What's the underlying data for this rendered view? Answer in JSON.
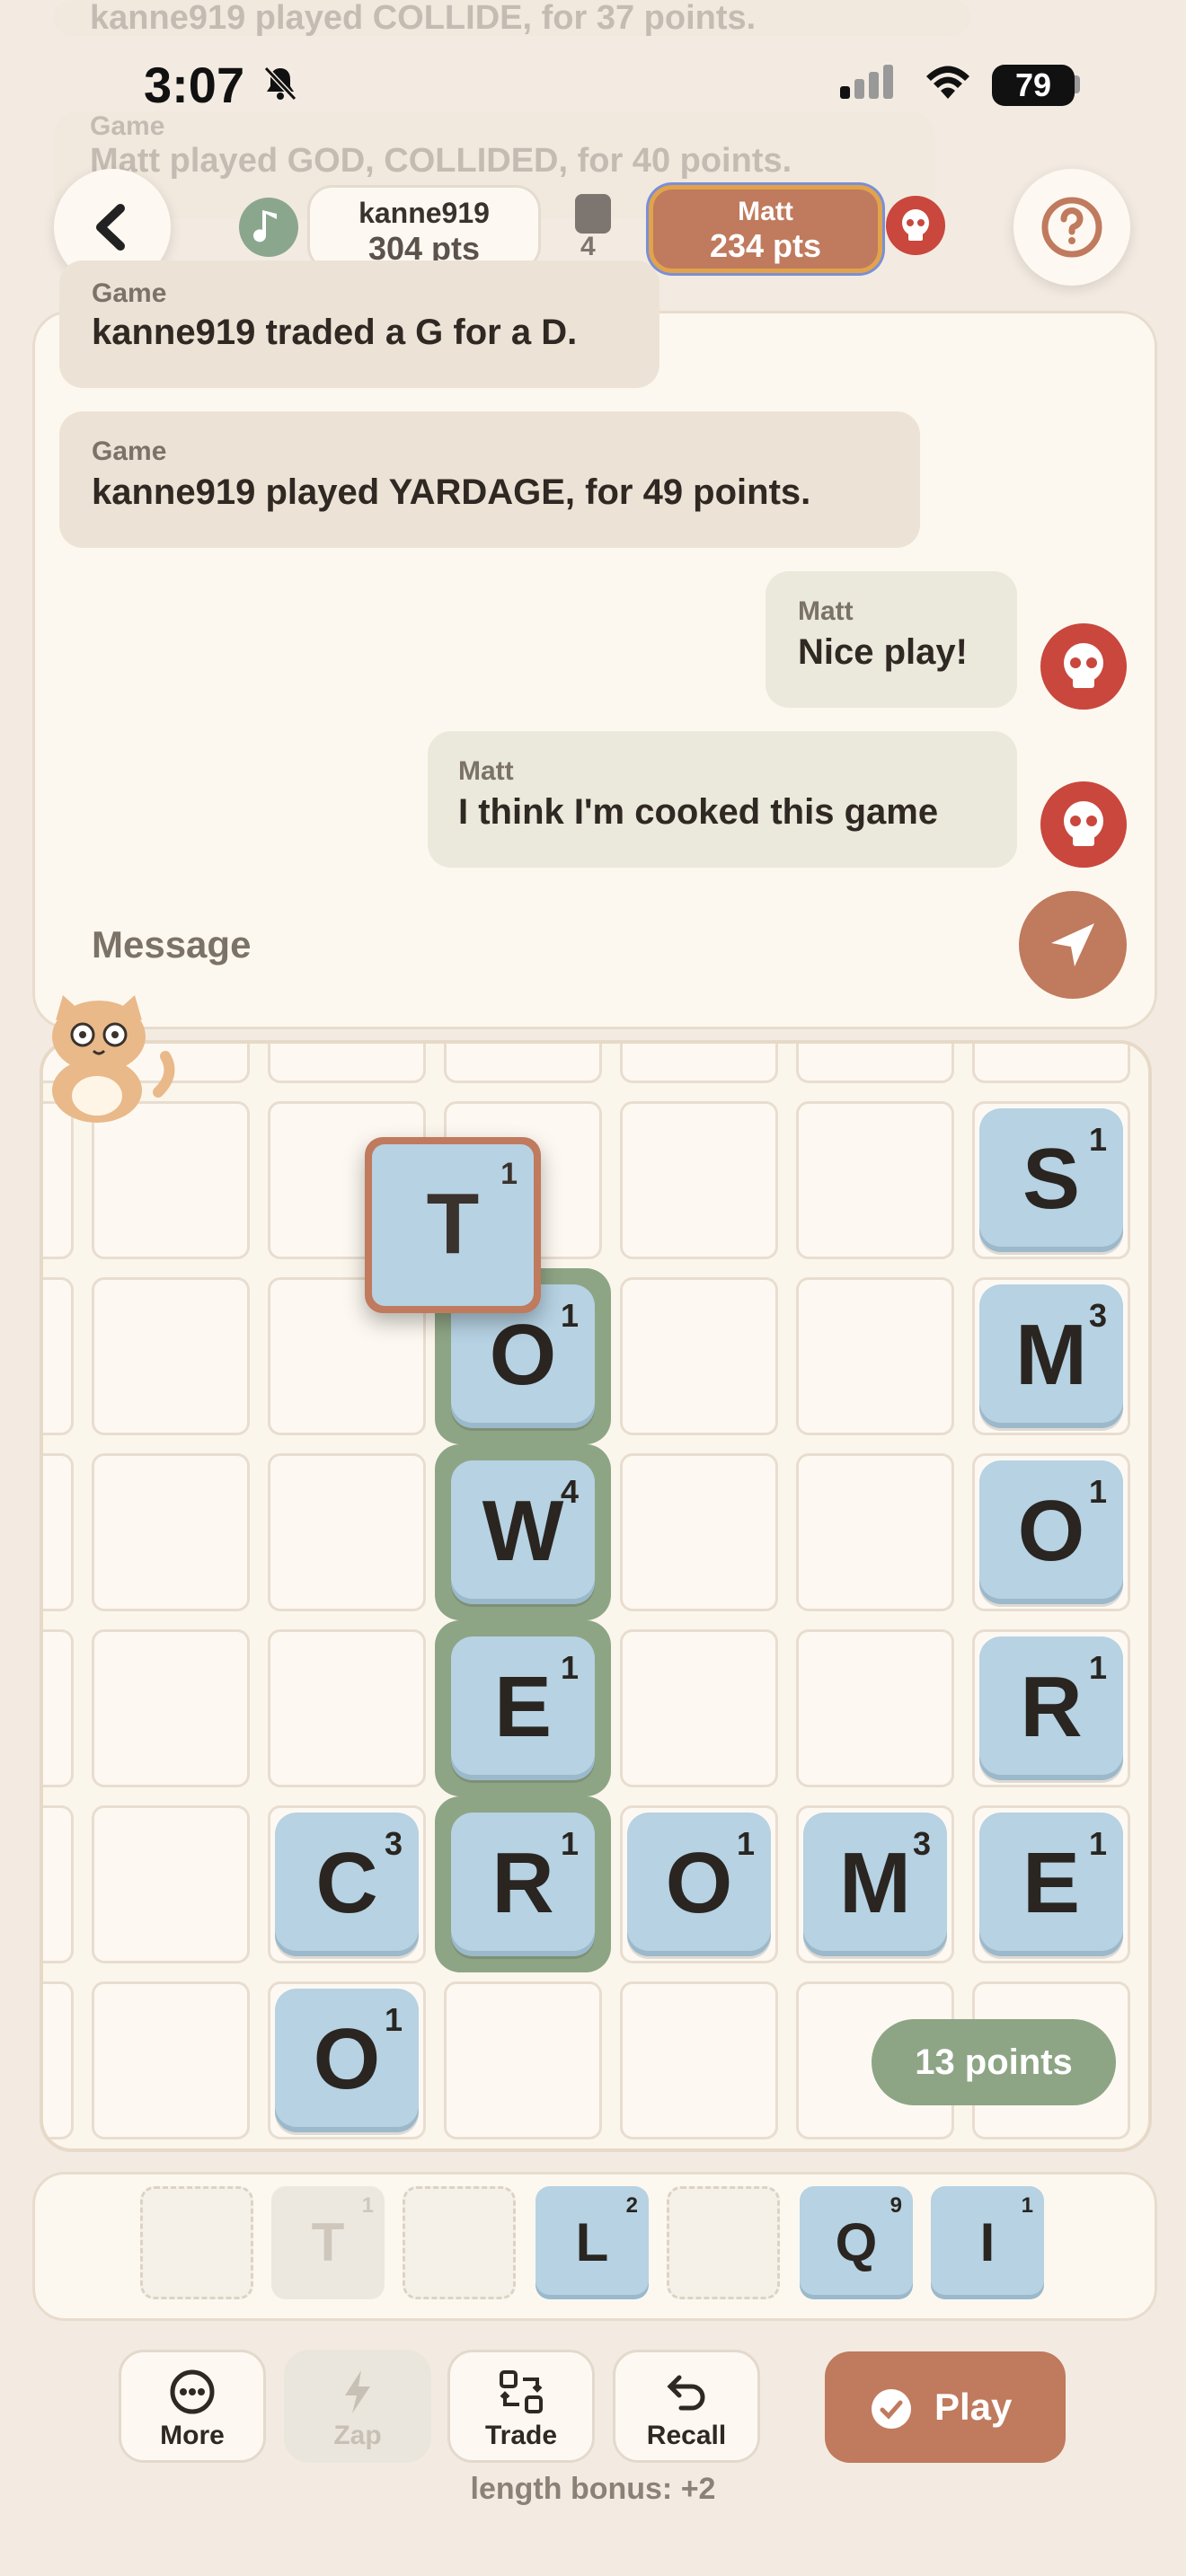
{
  "status_bar": {
    "time": "3:07",
    "battery": "79"
  },
  "background_log": [
    {
      "text": "kanne919 played COLLIDE, for 37 points."
    },
    {
      "who": "Game",
      "text": "Matt played GOD, COLLIDED, for 40 points."
    }
  ],
  "header": {
    "player1": {
      "name": "kanne919",
      "points": "304 pts"
    },
    "bag_count": "4",
    "player2": {
      "name": "Matt",
      "points": "234 pts"
    }
  },
  "chat": {
    "messages": [
      {
        "who": "Game",
        "text": "kanne919 traded a G for a D."
      },
      {
        "who": "Game",
        "text": "kanne919 played YARDAGE, for 49 points."
      },
      {
        "who": "Matt",
        "text": "Nice play!"
      },
      {
        "who": "Matt",
        "text": "I think I'm cooked this game"
      }
    ],
    "input_placeholder": "Message"
  },
  "board": {
    "dragging_tile": {
      "letter": "T",
      "score": "1"
    },
    "tiles": [
      {
        "letter": "S",
        "score": "1"
      },
      {
        "letter": "O",
        "score": "1"
      },
      {
        "letter": "M",
        "score": "3"
      },
      {
        "letter": "W",
        "score": "4"
      },
      {
        "letter": "O",
        "score": "1"
      },
      {
        "letter": "E",
        "score": "1"
      },
      {
        "letter": "R",
        "score": "1"
      },
      {
        "letter": "C",
        "score": "3"
      },
      {
        "letter": "R",
        "score": "1"
      },
      {
        "letter": "O",
        "score": "1"
      },
      {
        "letter": "M",
        "score": "3"
      },
      {
        "letter": "E",
        "score": "1"
      },
      {
        "letter": "O",
        "score": "1"
      }
    ],
    "points_badge": "13 points"
  },
  "rack": [
    {
      "letter": "T",
      "score": "1"
    },
    {
      "letter": "L",
      "score": "2"
    },
    {
      "letter": "Q",
      "score": "9"
    },
    {
      "letter": "I",
      "score": "1"
    }
  ],
  "actions": {
    "more": "More",
    "zap": "Zap",
    "trade": "Trade",
    "recall": "Recall",
    "play": "Play",
    "length_bonus": "length bonus: +2"
  },
  "colors": {
    "accent": "#c07a5d",
    "tile": "#b6d2e3",
    "highlight": "#8ea585",
    "danger": "#c9473d"
  }
}
